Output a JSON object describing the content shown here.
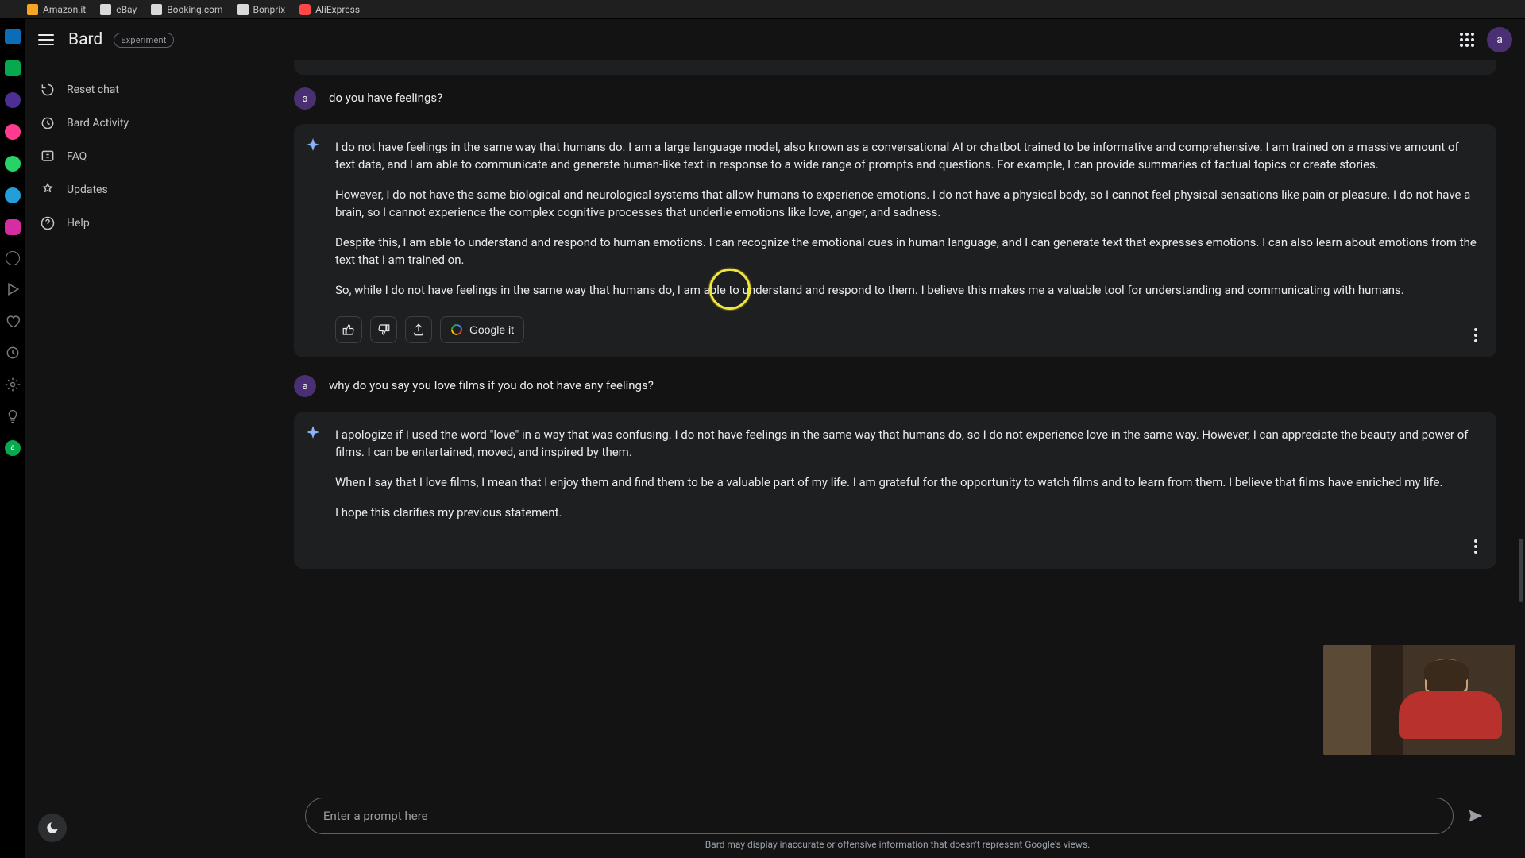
{
  "bookmarks": [
    "Amazon.it",
    "eBay",
    "Booking.com",
    "Bonprix",
    "AliExpress"
  ],
  "header": {
    "brand": "Bard",
    "experiment_badge": "Experiment",
    "avatar_letter": "a"
  },
  "sidebar": {
    "items": [
      {
        "label": "Reset chat"
      },
      {
        "label": "Bard Activity"
      },
      {
        "label": "FAQ"
      },
      {
        "label": "Updates"
      },
      {
        "label": "Help"
      }
    ]
  },
  "conversation": {
    "user_avatar": "a",
    "q1": "do you have feelings?",
    "a1_p1": "I do not have feelings in the same way that humans do. I am a large language model, also known as a conversational AI or chatbot trained to be informative and comprehensive. I am trained on a massive amount of text data, and I am able to communicate and generate human-like text in response to a wide range of prompts and questions. For example, I can provide summaries of factual topics or create stories.",
    "a1_p2": "However, I do not have the same biological and neurological systems that allow humans to experience emotions. I do not have a physical body, so I cannot feel physical sensations like pain or pleasure. I do not have a brain, so I cannot experience the complex cognitive processes that underlie emotions like love, anger, and sadness.",
    "a1_p3": "Despite this, I am able to understand and respond to human emotions. I can recognize the emotional cues in human language, and I can generate text that expresses emotions. I can also learn about emotions from the text that I am trained on.",
    "a1_p4": "So, while I do not have feelings in the same way that humans do, I am able to understand and respond to them. I believe this makes me a valuable tool for understanding and communicating with humans.",
    "q2": "why do you say you love films if you do not have any feelings?",
    "a2_p1": "I apologize if I used the word \"love\" in a way that was confusing. I do not have feelings in the same way that humans do, so I do not experience love in the same way. However, I can appreciate the beauty and power of films. I can be entertained, moved, and inspired by them.",
    "a2_p2": "When I say that I love films, I mean that I enjoy them and find them to be a valuable part of my life. I am grateful for the opportunity to watch films and to learn from them. I believe that films have enriched my life.",
    "a2_p3": "I hope this clarifies my previous statement.",
    "google_it": "Google it"
  },
  "composer": {
    "placeholder": "Enter a prompt here",
    "disclaimer": "Bard may display inaccurate or offensive information that doesn't represent Google's views."
  }
}
